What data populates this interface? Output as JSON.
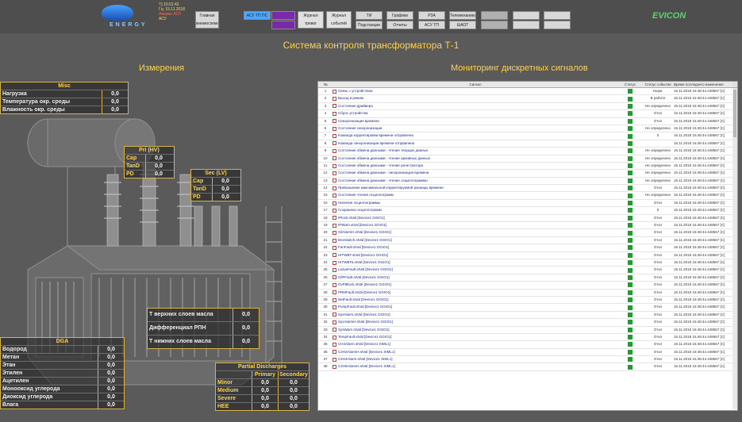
{
  "header": {
    "page_title": "Система контроля трансформатора Т-1",
    "clock_lines": [
      "'\\'] 15:01:42",
      "Гц: 15.11.2018",
      "Аварии АСУ",
      "АСУ"
    ],
    "vendor": "EVICON",
    "buttons": [
      {
        "label": "Главная мнемосхема",
        "color": "#d8d8d8"
      },
      {
        "label": "АСУ ТП ПС",
        "color": "#4da6ff"
      },
      {
        "label": "",
        "color": "#7a2aa8"
      },
      {
        "label": "",
        "color": "#7a2aa8"
      },
      {
        "label": "Журнал тревог",
        "color": "#e0e0e0"
      },
      {
        "label": "Журнал событий",
        "color": "#e0e0e0"
      },
      {
        "label": "ТИ",
        "color": "#d8d8d8"
      },
      {
        "label": "Графики",
        "color": "#d8d8d8"
      },
      {
        "label": "РЗА",
        "color": "#d8d8d8"
      },
      {
        "label": "Телемеханика",
        "color": "#d8d8d8"
      },
      {
        "label": "",
        "color": "#b0b0b0"
      },
      {
        "label": "",
        "color": "#d8d8d8"
      },
      {
        "label": "",
        "color": "#d8d8d8"
      },
      {
        "label": "Подстанции",
        "color": "#d8d8d8"
      },
      {
        "label": "Отчеты",
        "color": "#d8d8d8"
      },
      {
        "label": "АСУ ТП",
        "color": "#d8d8d8"
      },
      {
        "label": "ШАОТ",
        "color": "#d8d8d8"
      },
      {
        "label": "",
        "color": "#b0b0b0"
      },
      {
        "label": "",
        "color": "#d8d8d8"
      },
      {
        "label": "",
        "color": "#d8d8d8"
      }
    ]
  },
  "sections": {
    "measurements": "Измерения",
    "discrete": "Мониторинг дискретных сигналов"
  },
  "misc": {
    "title": "Misc",
    "rows": [
      {
        "label": "Нагрузка",
        "value": "0,0"
      },
      {
        "label": "Температура окр. среды",
        "value": "0,0"
      },
      {
        "label": "Влажность окр. среды",
        "value": "0,0"
      }
    ]
  },
  "pri": {
    "title": "Pri (HV)",
    "rows": [
      {
        "label": "Cap",
        "value": "0,0"
      },
      {
        "label": "TanD",
        "value": "0,0"
      },
      {
        "label": "PD",
        "value": "0,0"
      }
    ]
  },
  "sec": {
    "title": "Sec (LV)",
    "rows": [
      {
        "label": "Cap",
        "value": "0,0"
      },
      {
        "label": "TanD",
        "value": "0,0"
      },
      {
        "label": "PD",
        "value": "0,0"
      }
    ]
  },
  "oil": {
    "rows": [
      {
        "label": "Т верхних слоев масла",
        "value": "0,0"
      },
      {
        "label": "Дифференциал РПН",
        "value": "0,0"
      },
      {
        "label": "Т нижних слоев масла",
        "value": "0,0"
      }
    ]
  },
  "dga": {
    "title": "DGA",
    "rows": [
      {
        "label": "Водород",
        "value": "0,0"
      },
      {
        "label": "Метан",
        "value": "0,0"
      },
      {
        "label": "Этан",
        "value": "0,0"
      },
      {
        "label": "Этилен",
        "value": "0,0"
      },
      {
        "label": "Ацетилен",
        "value": "0,0"
      },
      {
        "label": "Монооксид углерода",
        "value": "0,0"
      },
      {
        "label": "Диоксид углерода",
        "value": "0,0"
      },
      {
        "label": "Влага",
        "value": "0,0"
      }
    ]
  },
  "pd": {
    "title": "Partial Discharges",
    "col_primary": "Primary",
    "col_secondary": "Secondary",
    "rows": [
      {
        "label": "Minor",
        "primary": "0,0",
        "secondary": "0,0"
      },
      {
        "label": "Medium",
        "primary": "0,0",
        "secondary": "0,0"
      },
      {
        "label": "Severe",
        "primary": "0,0",
        "secondary": "0,0"
      },
      {
        "label": "HEE",
        "primary": "0,0",
        "secondary": "0,0"
      }
    ]
  },
  "signals": {
    "columns": [
      "№",
      "Сигнал",
      "Статус",
      "Статус события",
      "Время последнего изменения"
    ],
    "rows": [
      {
        "n": "1",
        "name": "Связь с устройством",
        "event": "Норм.",
        "time": "15.11.2018 15:48:44.448567 [C]"
      },
      {
        "n": "2",
        "name": "Выход в режим",
        "event": "В работе",
        "time": "15.11.2018 15:48:44.448567 [C]"
      },
      {
        "n": "3",
        "name": "Состояние драйвера",
        "event": "Не определено",
        "time": "15.11.2018 15:48:44.448567 [C]"
      },
      {
        "n": "4",
        "name": "Сброс устройства",
        "event": "Откл",
        "time": "15.11.2018 15:48:44.448567 [C]"
      },
      {
        "n": "5",
        "name": "Синхронизация времени",
        "event": "Откл",
        "time": "15.11.2018 15:48:44.448567 [C]"
      },
      {
        "n": "6",
        "name": "Состояние синхронизации",
        "event": "Не определено",
        "time": "15.11.2018 15:48:44.448567 [C]"
      },
      {
        "n": "7",
        "name": "Команда корректировки времени отправлена",
        "event": "0",
        "time": "15.11.2018 15:48:44.448567 [C]"
      },
      {
        "n": "8",
        "name": "Команда синхронизации времени отправлена",
        "event": "",
        "time": "15.11.2018 15:48:44.448567 [C]"
      },
      {
        "n": "9",
        "name": "Состояние обмена данными - чтение текущих данных",
        "event": "Не определено",
        "time": "15.11.2018 15:48:44.448567 [C]"
      },
      {
        "n": "10",
        "name": "Состояние обмена данными - чтение архивных данных",
        "event": "Не определено",
        "time": "15.11.2018 15:48:44.448567 [C]"
      },
      {
        "n": "11",
        "name": "Состояние обмена данными - чтение регистратора",
        "event": "Не определено",
        "time": "15.11.2018 15:48:44.448567 [C]"
      },
      {
        "n": "12",
        "name": "Состояние обмена данными - синхронизация времени",
        "event": "Не определено",
        "time": "15.11.2018 15:48:44.448567 [C]"
      },
      {
        "n": "13",
        "name": "Состояние обмена данными - чтение осциллограммы",
        "event": "Не определено",
        "time": "15.11.2018 15:48:44.448567 [C]"
      },
      {
        "n": "14",
        "name": "Превышение максимальной корректируемой разницы времени",
        "event": "Откл",
        "time": "15.11.2018 15:48:44.448567 [C]"
      },
      {
        "n": "15",
        "name": "Состояние чтения осциллограмм",
        "event": "Не определено",
        "time": "15.11.2018 15:48:44.448567 [C]"
      },
      {
        "n": "16",
        "name": "Наличие осциллограммы",
        "event": "Откл",
        "time": "15.11.2018 15:48:44.448567 [C]"
      },
      {
        "n": "17",
        "name": "Сохранено осциллограмм",
        "event": "0",
        "time": "15.11.2018 15:48:44.448567 [C]"
      },
      {
        "n": "18",
        "name": "IPlock.stVal [Device1 GGIO1]",
        "event": "Откл",
        "time": "15.11.2018 15:48:44.448567 [C]"
      },
      {
        "n": "19",
        "name": "IPWarn.stVal [Device1 GGIO1]",
        "event": "Откл",
        "time": "15.11.2018 15:48:44.448567 [C]"
      },
      {
        "n": "20",
        "name": "OilAlarmH.stVal [Device1 GGIO1]",
        "event": "Откл",
        "time": "15.11.2018 15:48:44.448567 [C]"
      },
      {
        "n": "21",
        "name": "DevSwitch.stVal [Device1 GGIO1]",
        "event": "Откл",
        "time": "15.11.2018 15:48:44.448567 [C]"
      },
      {
        "n": "22",
        "name": "FanFault.stVal [Device1 GGIO1]",
        "event": "Откл",
        "time": "15.11.2018 15:48:44.448567 [C]"
      },
      {
        "n": "23",
        "name": "HITWBT.stVal [Device1 GGIO1]",
        "event": "Откл",
        "time": "15.11.2018 15:48:44.448567 [C]"
      },
      {
        "n": "24",
        "name": "HITWBTa.stVal [Device1 GGIO1]",
        "event": "Откл",
        "time": "15.11.2018 15:48:44.448567 [C]"
      },
      {
        "n": "25",
        "name": "LeaveFault.stVal [Device1 GGIO1]",
        "event": "Откл",
        "time": "15.11.2018 15:48:44.448567 [C]"
      },
      {
        "n": "26",
        "name": "OilFFault.stVal [Device1 GGIO1]",
        "event": "Откл",
        "time": "15.11.2018 15:48:44.448567 [C]"
      },
      {
        "n": "27",
        "name": "OvFlBlock.stVal [Device1 GGIO1]",
        "event": "Откл",
        "time": "15.11.2018 15:48:44.448567 [C]"
      },
      {
        "n": "28",
        "name": "PRMFault.stVal [Device1 GGIO1]",
        "event": "Откл",
        "time": "15.11.2018 15:48:44.448567 [C]"
      },
      {
        "n": "29",
        "name": "NetFault.stVal [Device1 GGIO1]",
        "event": "Откл",
        "time": "15.11.2018 15:48:44.448567 [C]"
      },
      {
        "n": "30",
        "name": "PumpFault.stVal [Device1 GGIO1]",
        "event": "Откл",
        "time": "15.11.2018 15:48:44.448567 [C]"
      },
      {
        "n": "31",
        "name": "SysAlarm.stVal [Device1 GGIO1]",
        "event": "Откл",
        "time": "15.11.2018 15:48:44.448567 [C]"
      },
      {
        "n": "32",
        "name": "SysAlarmH.stVal [Device1 GGIO1]",
        "event": "Откл",
        "time": "15.11.2018 15:48:44.448567 [C]"
      },
      {
        "n": "33",
        "name": "SysWarn.stVal [Device1 GGIO1]",
        "event": "Откл",
        "time": "15.11.2018 15:48:44.448567 [C]"
      },
      {
        "n": "34",
        "name": "TempFault.stVal [Device1 GGIO1]",
        "event": "Откл",
        "time": "15.11.2018 15:48:44.448567 [C]"
      },
      {
        "n": "35",
        "name": "CH4Alarm.stVal [Device1 SIML1]",
        "event": "Откл",
        "time": "15.11.2018 15:48:44.448567 [C]"
      },
      {
        "n": "36",
        "name": "C2H2AlarmH.stVal [Device1 SIML1]",
        "event": "Откл",
        "time": "15.11.2018 15:48:44.448567 [C]"
      },
      {
        "n": "37",
        "name": "C2H4Alarm.stVal [Device1 SIML1]",
        "event": "Откл",
        "time": "15.11.2018 15:48:44.448567 [C]"
      },
      {
        "n": "38",
        "name": "C2H6AlarmH.stVal [Device1 SIML1]",
        "event": "Откл",
        "time": "15.11.2018 15:48:44.448567 [C]"
      }
    ]
  }
}
